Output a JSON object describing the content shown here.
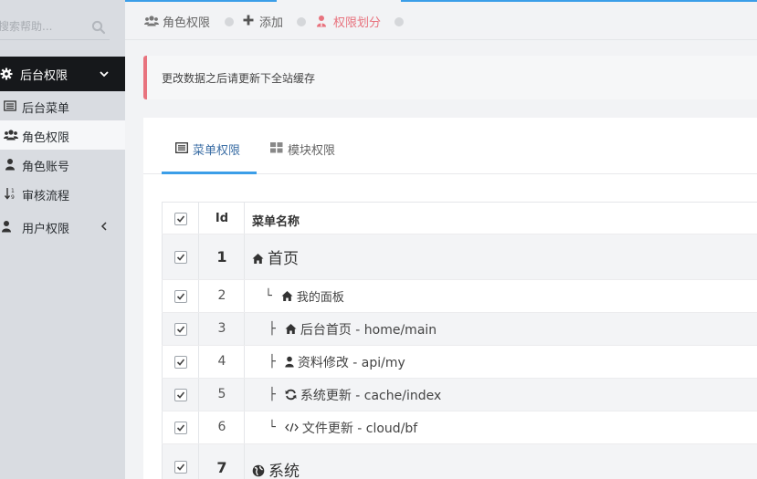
{
  "sidebar": {
    "search_placeholder": "搜索帮助...",
    "group_label": "后台权限",
    "items": [
      {
        "label": "后台菜单",
        "icon": "list-icon"
      },
      {
        "label": "角色权限",
        "icon": "users-icon",
        "active": true
      },
      {
        "label": "角色账号",
        "icon": "user-icon"
      },
      {
        "label": "审核流程",
        "icon": "sort-icon"
      },
      {
        "label": "用户权限",
        "icon": "user-icon"
      }
    ]
  },
  "breadcrumb": {
    "items": [
      {
        "label": "角色权限",
        "icon": "users-icon"
      },
      {
        "label": "添加",
        "icon": "plus-icon"
      },
      {
        "label": "权限划分",
        "icon": "user-icon",
        "active": true
      }
    ]
  },
  "notice": "更改数据之后请更新下全站缓存",
  "tabs": [
    {
      "label": "菜单权限",
      "icon": "list-icon",
      "active": true
    },
    {
      "label": "模块权限",
      "icon": "grid-icon"
    }
  ],
  "table": {
    "headers": {
      "id": "Id",
      "name": "菜单名称"
    },
    "rows": [
      {
        "id": "1",
        "tree": "",
        "icon": "home-icon",
        "name": "首页",
        "level": 0
      },
      {
        "id": "2",
        "tree": "└",
        "icon": "home-icon",
        "name": "我的面板",
        "level": 1
      },
      {
        "id": "3",
        "tree": "├",
        "icon": "home-icon",
        "name": "后台首页 - home/main",
        "level": 1
      },
      {
        "id": "4",
        "tree": "├",
        "icon": "user-icon",
        "name": "资料修改 - api/my",
        "level": 1
      },
      {
        "id": "5",
        "tree": "├",
        "icon": "refresh-icon",
        "name": "系统更新 - cache/index",
        "level": 1
      },
      {
        "id": "6",
        "tree": "└",
        "icon": "code-icon",
        "name": "文件更新 - cloud/bf",
        "level": 1
      },
      {
        "id": "7",
        "tree": "",
        "icon": "globe-icon",
        "name": "系统",
        "level": 0
      }
    ]
  },
  "colors": {
    "accent_blue": "#3b9ee8",
    "accent_red": "#e8737e",
    "sidebar_bg": "#d9dce1",
    "sidebar_active_group": "#16181b"
  }
}
